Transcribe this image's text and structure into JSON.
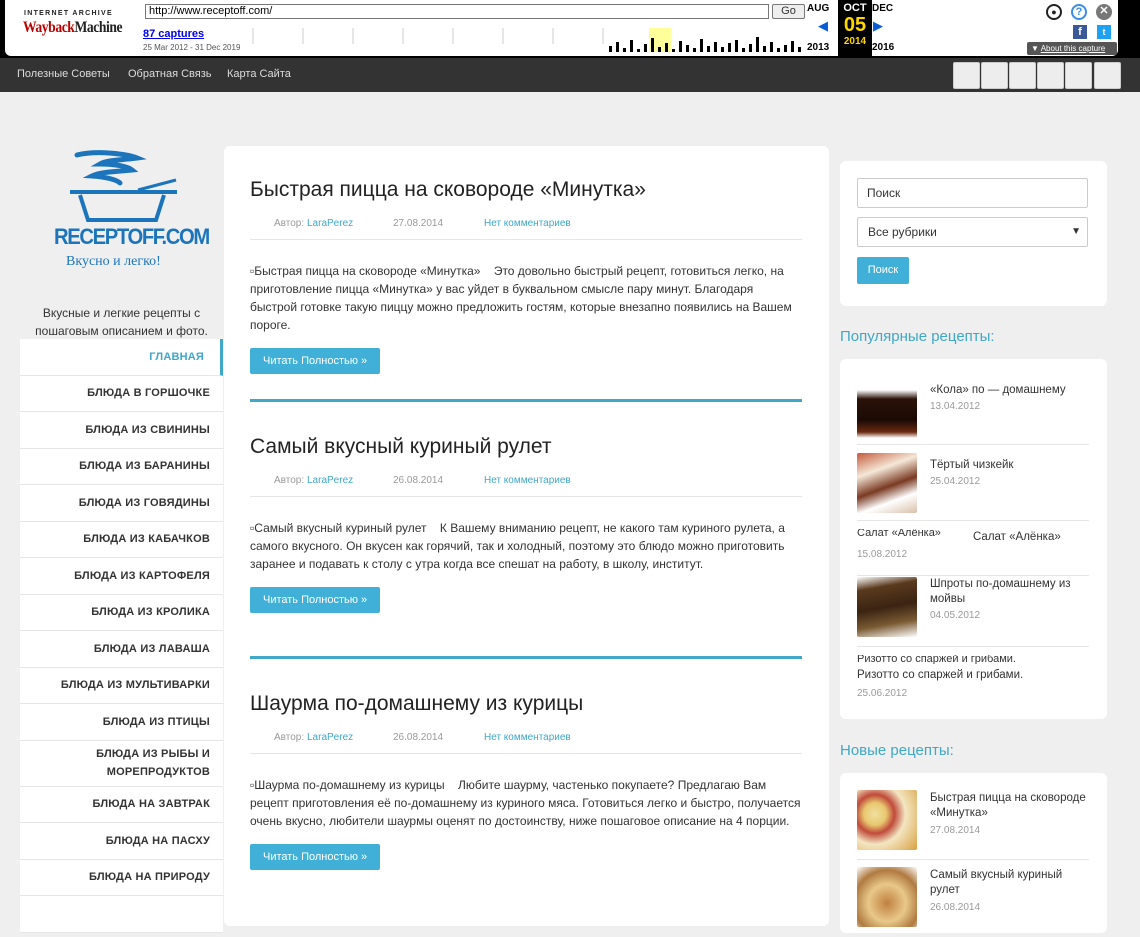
{
  "wayback": {
    "ia_label": "INTERNET ARCHIVE",
    "logo_a": "Wayback",
    "logo_b": "Machine",
    "url": "http://www.receptoff.com/",
    "go": "Go",
    "captures": "87 captures",
    "range": "25 Mar 2012 - 31 Dec 2019",
    "prev_month": "AUG",
    "cur_month": "OCT",
    "next_month": "DEC",
    "prev_year": "2013",
    "cur_day": "05",
    "cur_year": "2014",
    "next_year": "2016",
    "about": "About this capture"
  },
  "topnav": {
    "links": [
      "Полезные Советы",
      "Обратная Связь",
      "Карта Сайта"
    ]
  },
  "site": {
    "logo_text": "RECEPTOFF.COM",
    "logo_sub": "Вкусно и легко!",
    "tagline": "Вкусные и легкие рецепты с пошаговым описанием и фото."
  },
  "menu": [
    "ГЛАВНАЯ",
    "БЛЮДА В ГОРШОЧКЕ",
    "БЛЮДА ИЗ СВИНИНЫ",
    "БЛЮДА ИЗ БАРАНИНЫ",
    "БЛЮДА ИЗ ГОВЯДИНЫ",
    "БЛЮДА ИЗ КАБАЧКОВ",
    "БЛЮДА ИЗ КАРТОФЕЛЯ",
    "БЛЮДА ИЗ КРОЛИКА",
    "БЛЮДА ИЗ ЛАВАША",
    "БЛЮДА ИЗ МУЛЬТИВАРКИ",
    "БЛЮДА ИЗ ПТИЦЫ",
    "БЛЮДА ИЗ РЫБЫ И МОРЕПРОДУКТОВ",
    "БЛЮДА НА ЗАВТРАК",
    "БЛЮДА НА ПАСХУ",
    "БЛЮДА НА ПРИРОДУ"
  ],
  "posts": [
    {
      "title": "Быстрая пицца на сковороде «Минутка»",
      "author_label": "Автор:",
      "author": "LaraPerez",
      "date": "27.08.2014",
      "comments": "Нет комментариев",
      "img_alt": "Быстрая пицца на сковороде «Минутка»",
      "text": "Это довольно быстрый рецепт, готовиться легко, на приготовление пицца «Минутка» у вас уйдет в буквальном смысле пару минут. Благодаря быстрой готовке такую пиццу можно предложить гостям, которые внезапно появились на Вашем пороге.",
      "button": "Читать Полностью »"
    },
    {
      "title": "Самый вкусный куриный рулет",
      "author_label": "Автор:",
      "author": "LaraPerez",
      "date": "26.08.2014",
      "comments": "Нет комментариев",
      "img_alt": "Самый вкусный куриный рулет",
      "text": "К Вашему вниманию рецепт, не какого там куриного рулета, а самого вкусного. Он вкусен как горячий, так и холодный, поэтому это блюдо можно приготовить заранее и подавать к столу с утра когда все спешат на работу, в школу, институт.",
      "button": "Читать Полностью »"
    },
    {
      "title": "Шаурма по-домашнему из курицы",
      "author_label": "Автор:",
      "author": "LaraPerez",
      "date": "26.08.2014",
      "comments": "Нет комментариев",
      "img_alt": "Шаурма по-домашнему из курицы",
      "text": "Любите шаурму, частенько покупаете? Предлагаю Вам рецепт приготовления её по-домашнему из куриного мяса. Готовиться легко и быстро, получается очень вкусно, любители шаурмы оценят по достоинству, ниже пошаговое описание на 4 порции.",
      "button": "Читать Полностью »"
    }
  ],
  "search": {
    "placeholder": "Поиск",
    "select": "Все рубрики",
    "button": "Поиск"
  },
  "popular": {
    "heading": "Популярные рецепты:",
    "items": [
      {
        "title": "«Кола» по — домашнему",
        "date": "13.04.2012"
      },
      {
        "title": "Тёртый чизкейк",
        "date": "25.04.2012"
      },
      {
        "title": "Салат «Алёнка»",
        "alt": "Салат «Алёнка»",
        "date": "15.08.2012"
      },
      {
        "title": "Шпроты по-домашнему из мойвы",
        "date": "04.05.2012"
      },
      {
        "title": "Ризотто со спаржей и грибами.",
        "alt": "Ризотто со спаржей и грибами.",
        "date": "25.06.2012"
      }
    ]
  },
  "newest": {
    "heading": "Новые рецепты:",
    "items": [
      {
        "title": "Быстрая пицца на сковороде «Минутка»",
        "date": "27.08.2014"
      },
      {
        "title": "Самый вкусный куриный рулет",
        "date": "26.08.2014"
      }
    ]
  }
}
